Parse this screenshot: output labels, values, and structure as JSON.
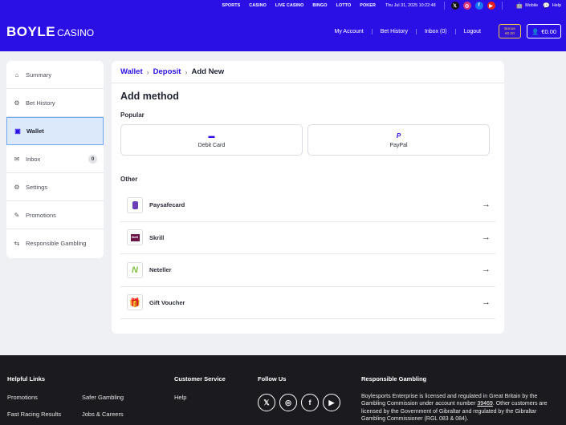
{
  "topbar": {
    "nav": [
      "SPORTS",
      "CASINO",
      "LIVE CASINO",
      "BINGO",
      "LOTTO",
      "POKER"
    ],
    "datetime": "Thu Jul 31, 2025 10:22:48",
    "mobile_label": "Mobile",
    "help_label": "Help"
  },
  "header": {
    "logo_main": "BOYLE",
    "logo_sub": "CASINO",
    "links": [
      "My Account",
      "Bet History",
      "Inbox (0)",
      "Logout"
    ],
    "bonus_line1": "Bonus",
    "bonus_line2": "€0.00",
    "balance": "€0.00"
  },
  "sidebar": {
    "items": [
      {
        "label": "Summary",
        "icon": "home-icon"
      },
      {
        "label": "Bet History",
        "icon": "history-icon"
      },
      {
        "label": "Wallet",
        "icon": "wallet-icon",
        "active": true
      },
      {
        "label": "Inbox",
        "icon": "mail-icon",
        "badge": "0"
      },
      {
        "label": "Settings",
        "icon": "gear-icon"
      },
      {
        "label": "Promotions",
        "icon": "megaphone-icon"
      },
      {
        "label": "Responsible Gambling",
        "icon": "sliders-icon"
      }
    ]
  },
  "main": {
    "breadcrumb": {
      "wallet": "Wallet",
      "deposit": "Deposit",
      "current": "Add New"
    },
    "title": "Add method",
    "popular_label": "Popular",
    "popular": [
      {
        "label": "Debit Card",
        "icon": "card-icon"
      },
      {
        "label": "PayPal",
        "icon": "paypal-icon"
      }
    ],
    "other_label": "Other",
    "other": [
      {
        "label": "Paysafecard",
        "icon": "paysafecard-icon"
      },
      {
        "label": "Skrill",
        "icon": "skrill-icon",
        "logo_text": "Skrill"
      },
      {
        "label": "Neteller",
        "icon": "neteller-icon",
        "logo_text": "N"
      },
      {
        "label": "Gift Voucher",
        "icon": "gift-icon"
      }
    ]
  },
  "footer": {
    "helpful_links_heading": "Helpful Links",
    "helpful_links": [
      "Promotions",
      "Safer Gambling",
      "Fast Racing Results",
      "Jobs & Careers"
    ],
    "customer_service_heading": "Customer Service",
    "customer_service_links": [
      "Help"
    ],
    "follow_heading": "Follow Us",
    "responsible_heading": "Responsible Gambling",
    "responsible_text_1": "Boylesports Enterprise is licensed and regulated in Great Britain by the Gambling Commission under account number ",
    "responsible_account": "39469",
    "responsible_text_2": ". Other customers are licensed by the Government of Gibraltar and regulated by the Gibraltar Gambling Commissioner (RGL 083 & 084)."
  }
}
